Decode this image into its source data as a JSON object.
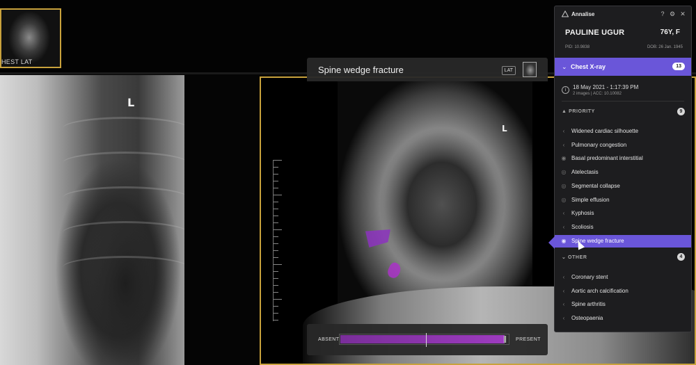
{
  "viewer": {
    "thumbnail_label": "HEST LAT",
    "left_marker": "L",
    "right_marker": "L",
    "finding_title": "Spine wedge fracture",
    "view_badge": "LAT",
    "confidence": {
      "absent_label": "ABSENT",
      "present_label": "PRESENT",
      "level": 0.97,
      "threshold": 0.51
    },
    "overlay_color": "#8c32be",
    "frame_color": "#c9a23c"
  },
  "panel": {
    "brand": "Annalise",
    "header_icons": [
      "help-icon",
      "settings-icon",
      "close-icon"
    ],
    "patient_name": "PAULINE UGUR",
    "age_sex": "76Y, F",
    "pid": "PID: 10.9838",
    "dob": "DOB: 26 Jan. 1945",
    "study": {
      "title": "Chest X-ray",
      "count": "13",
      "datetime": "18 May 2021 - 1:17:39 PM",
      "meta": "2 images  |  ACC: 10.10082"
    },
    "priority": {
      "label": "PRIORITY",
      "count": "9",
      "items": [
        {
          "label": "Widened cardiac silhouette",
          "icon": "chevron-left"
        },
        {
          "label": "Pulmonary congestion",
          "icon": "chevron-left"
        },
        {
          "label": "Basal predominant interstitial",
          "icon": "eye"
        },
        {
          "label": "Atelectasis",
          "icon": "eye-slash"
        },
        {
          "label": "Segmental collapse",
          "icon": "eye-slash"
        },
        {
          "label": "Simple effusion",
          "icon": "eye-slash"
        },
        {
          "label": "Kyphosis",
          "icon": "chevron-left"
        },
        {
          "label": "Scoliosis",
          "icon": "chevron-left"
        },
        {
          "label": "Spine wedge fracture",
          "icon": "eye"
        }
      ]
    },
    "other": {
      "label": "OTHER",
      "count": "4",
      "items": [
        {
          "label": "Coronary stent",
          "icon": "chevron-left"
        },
        {
          "label": "Aortic arch calcification",
          "icon": "chevron-left"
        },
        {
          "label": "Spine arthritis",
          "icon": "chevron-left"
        },
        {
          "label": "Osteopaenia",
          "icon": "chevron-left"
        }
      ]
    },
    "accent_color": "#6a56d9"
  }
}
